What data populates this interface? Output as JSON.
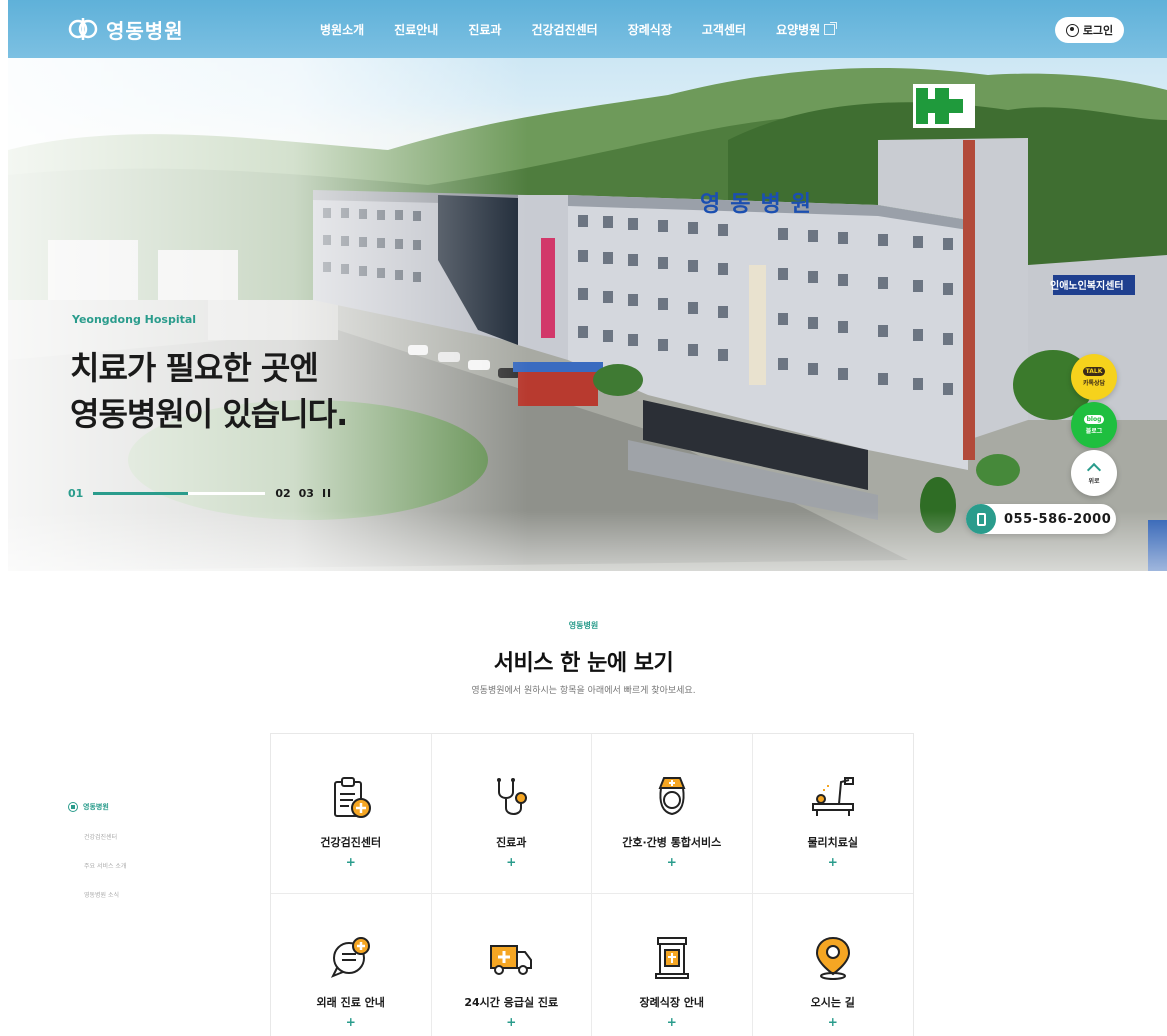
{
  "header": {
    "logo_text": "영동병원",
    "nav": [
      "병원소개",
      "진료안내",
      "진료과",
      "건강검진센터",
      "장례식장",
      "고객센터",
      "요양병원"
    ],
    "login_label": "로그인"
  },
  "hero": {
    "eyebrow": "Yeongdong Hospital",
    "title_line1": "치료가 필요한 곳엔",
    "title_line2": "영동병원이 있습니다.",
    "slide_current": "01",
    "slide_next_a": "02",
    "slide_next_b": "03",
    "pause_label": "II",
    "slide_progress": 0.55,
    "building_sign": "영동병원",
    "side_sign": "인애노인복지센터"
  },
  "quick": {
    "kakao_badge": "TALK",
    "kakao_label": "카톡상담",
    "blog_badge": "blog",
    "blog_label": "블로그",
    "top_label": "위로",
    "phone": "055-586-2000"
  },
  "service": {
    "eyebrow": "영동병원",
    "title": "서비스 한 눈에 보기",
    "desc": "영동병원에서 원하시는 항목을 아래에서 빠르게 찾아보세요.",
    "side_head": "영동병원",
    "side_items": [
      "건강검진센터",
      "주요 서비스 소개",
      "영동병원 소식"
    ],
    "items": [
      {
        "label": "건강검진센터",
        "icon": "clipboard-plus-icon"
      },
      {
        "label": "진료과",
        "icon": "stethoscope-icon"
      },
      {
        "label": "간호·간병 통합서비스",
        "icon": "nurse-icon"
      },
      {
        "label": "물리치료실",
        "icon": "physio-bed-icon"
      },
      {
        "label": "외래 진료 안내",
        "icon": "chat-plus-icon"
      },
      {
        "label": "24시간 응급실 진료",
        "icon": "ambulance-icon"
      },
      {
        "label": "장례식장 안내",
        "icon": "memorial-icon"
      },
      {
        "label": "오시는 길",
        "icon": "map-pin-icon"
      }
    ],
    "plus": "+"
  },
  "colors": {
    "accent": "#2a9c8c",
    "header": "#6bb8de",
    "icon_orange": "#f5a623"
  }
}
